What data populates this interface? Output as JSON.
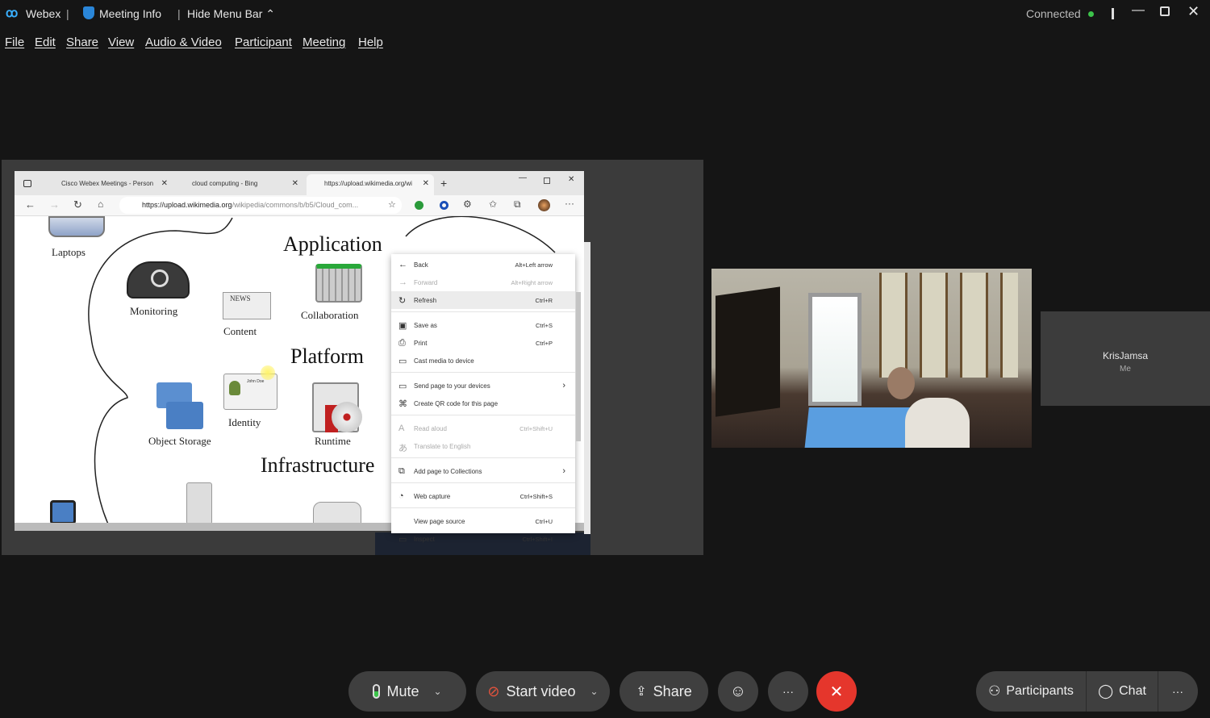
{
  "titlebar": {
    "app": "Webex",
    "meeting_info": "Meeting Info",
    "hide_menu": "Hide Menu Bar",
    "status": "Connected",
    "status_color": "#3cc34a"
  },
  "menu": [
    "File",
    "Edit",
    "Share",
    "View",
    "Audio & Video",
    "Participant",
    "Meeting",
    "Help"
  ],
  "browser": {
    "tabs": [
      "Cisco Webex Meetings - Person",
      "cloud computing - Bing",
      "https://upload.wikimedia.org/wi"
    ],
    "url_host": "https://upload.wikimedia.org",
    "url_path": "/wikipedia/commons/b/b5/Cloud_com..."
  },
  "diagram": {
    "headings": [
      "Application",
      "Platform",
      "Infrastructure"
    ],
    "labels": [
      "Laptops",
      "Monitoring",
      "Content",
      "Collaboration",
      "Identity",
      "Object Storage",
      "Runtime"
    ],
    "news": "NEWS",
    "id_name": "John Doe"
  },
  "context_menu": [
    {
      "label": "Back",
      "shortcut": "Alt+Left arrow",
      "icon": "arrow-left"
    },
    {
      "label": "Forward",
      "shortcut": "Alt+Right arrow",
      "icon": "arrow-right",
      "disabled": true
    },
    {
      "label": "Refresh",
      "shortcut": "Ctrl+R",
      "icon": "refresh",
      "highlight": true
    },
    {
      "label": "Save as",
      "shortcut": "Ctrl+S",
      "icon": "save",
      "sep": true
    },
    {
      "label": "Print",
      "shortcut": "Ctrl+P",
      "icon": "print"
    },
    {
      "label": "Cast media to device",
      "shortcut": "",
      "icon": "cast"
    },
    {
      "label": "Send page to your devices",
      "shortcut": "",
      "icon": "devices",
      "sep": true,
      "submenu": true
    },
    {
      "label": "Create QR code for this page",
      "shortcut": "",
      "icon": "qr"
    },
    {
      "label": "Read aloud",
      "shortcut": "Ctrl+Shift+U",
      "icon": "read-aloud",
      "disabled": true,
      "sep": true
    },
    {
      "label": "Translate to English",
      "shortcut": "",
      "icon": "translate",
      "disabled": true
    },
    {
      "label": "Add page to Collections",
      "shortcut": "",
      "icon": "collections",
      "sep": true,
      "submenu": true
    },
    {
      "label": "Web capture",
      "shortcut": "Ctrl+Shift+S",
      "icon": "capture",
      "sep": true
    },
    {
      "label": "View page source",
      "shortcut": "Ctrl+U",
      "icon": "",
      "sep": true
    },
    {
      "label": "Inspect",
      "shortcut": "Ctrl+Shift+I",
      "icon": "inspect"
    }
  ],
  "self_tile": {
    "name": "KrisJamsa",
    "sub": "Me"
  },
  "controls": {
    "mute": "Mute",
    "start_video": "Start video",
    "share": "Share",
    "participants": "Participants",
    "chat": "Chat",
    "more": "···",
    "end_color": "#e5362c",
    "video_off_color": "#e5533d"
  }
}
